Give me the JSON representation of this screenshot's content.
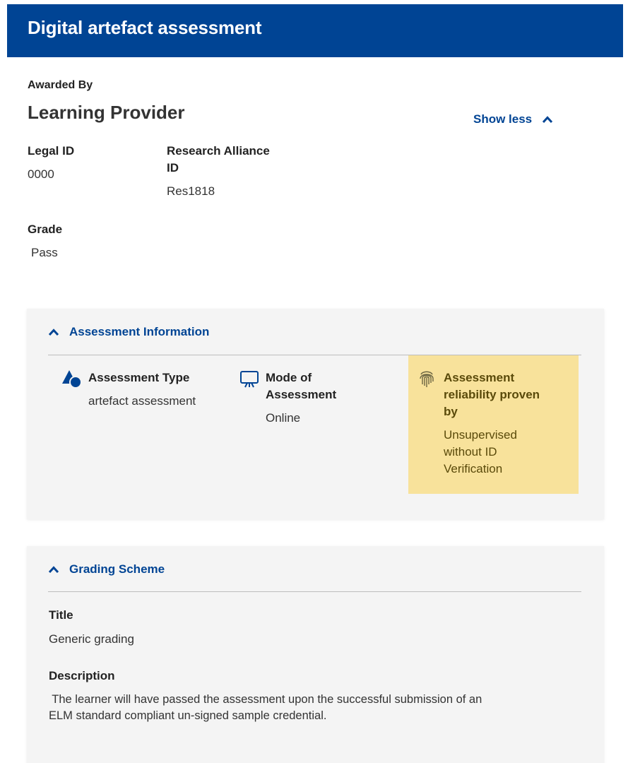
{
  "header": {
    "title": "Digital artefact assessment"
  },
  "awarded": {
    "label": "Awarded By",
    "provider": "Learning Provider",
    "show_less": "Show less",
    "legal_id_label": "Legal ID",
    "legal_id_value": "0000",
    "research_label_line1": "Research Alliance",
    "research_label_line2": "ID",
    "research_value": "Res1818",
    "grade_label": "Grade",
    "grade_value": "Pass"
  },
  "assessment_info": {
    "heading": "Assessment Information",
    "type_label": "Assessment Type",
    "type_value": "artefact assessment",
    "mode_label_line1": "Mode of",
    "mode_label_line2": "Assessment",
    "mode_value": "Online",
    "reliability_label_line1": "Assessment",
    "reliability_label_line2": "reliability proven",
    "reliability_label_line3": "by",
    "reliability_value_line1": "Unsupervised",
    "reliability_value_line2": "without ID",
    "reliability_value_line3": "Verification",
    "highlight_color": "#f8e29b"
  },
  "grading_scheme": {
    "heading": "Grading Scheme",
    "title_label": "Title",
    "title_value": "Generic grading",
    "description_label": "Description",
    "description_line1": " The learner will have passed the assessment upon the successful submission of an",
    "description_line2": "ELM standard compliant un-signed sample credential."
  },
  "icons": {
    "chevron": "chevron-up-icon",
    "shapes": "shapes-icon",
    "presentation": "presentation-board-icon",
    "fingerprint": "fingerprint-icon"
  },
  "colors": {
    "brand": "#004494",
    "panel_bg": "#f4f4f4"
  }
}
